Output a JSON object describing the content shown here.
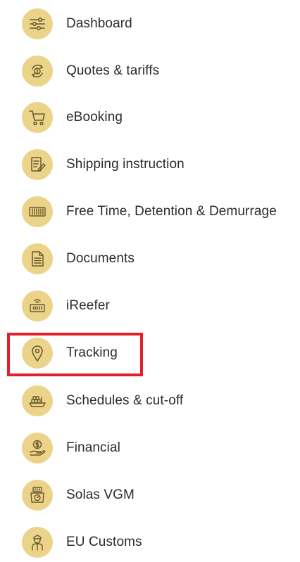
{
  "menu": {
    "items": [
      {
        "label": "Dashboard",
        "icon": "sliders-icon"
      },
      {
        "label": "Quotes & tariffs",
        "icon": "dollar-cycle-icon"
      },
      {
        "label": "eBooking",
        "icon": "shopping-cart-icon"
      },
      {
        "label": "Shipping instruction",
        "icon": "document-edit-icon"
      },
      {
        "label": "Free Time, Detention & Demurrage",
        "icon": "container-icon"
      },
      {
        "label": "Documents",
        "icon": "document-icon"
      },
      {
        "label": "iReefer",
        "icon": "reefer-container-icon"
      },
      {
        "label": "Tracking",
        "icon": "location-pin-icon"
      },
      {
        "label": "Schedules & cut-off",
        "icon": "ship-icon"
      },
      {
        "label": "Financial",
        "icon": "coin-hand-icon"
      },
      {
        "label": "Solas VGM",
        "icon": "weight-scale-icon"
      },
      {
        "label": "EU Customs",
        "icon": "customs-officer-icon"
      }
    ],
    "highlighted_item": "Tracking"
  },
  "colors": {
    "icon_background": "#ecd38a",
    "icon_stroke": "#6b5a2a",
    "label_text": "#2b2b2b",
    "highlight_border": "#e3202a"
  }
}
